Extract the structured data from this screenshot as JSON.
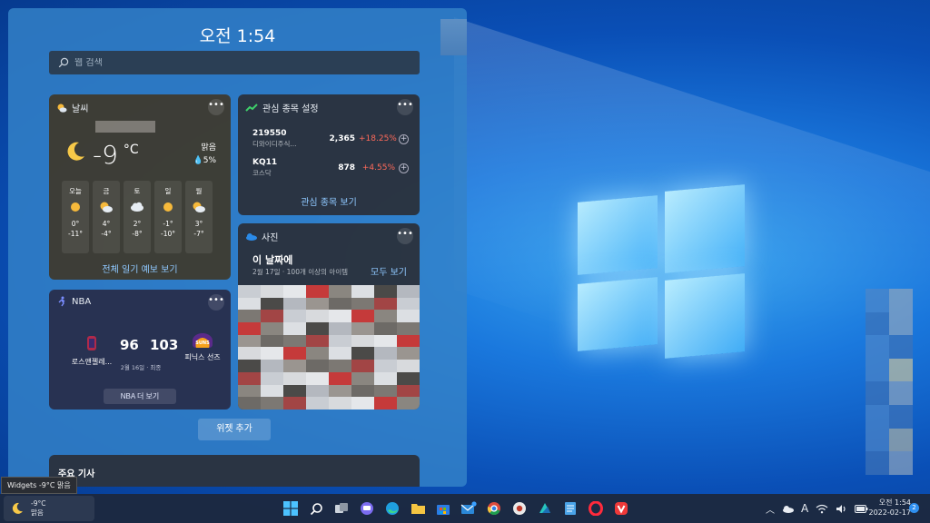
{
  "panel": {
    "clock": "오전 1:54",
    "search": {
      "placeholder": "웹 검색"
    }
  },
  "weather": {
    "title": "날씨",
    "temperature": "-9",
    "unit": "°C",
    "condition": "맑음",
    "precip": "5%",
    "forecast": [
      {
        "day": "오늘",
        "icon": "sun-icon",
        "high": "0°",
        "low": "-11°"
      },
      {
        "day": "금",
        "icon": "partly-cloudy-icon",
        "high": "4°",
        "low": "-4°"
      },
      {
        "day": "토",
        "icon": "cloud-icon",
        "high": "2°",
        "low": "-8°"
      },
      {
        "day": "일",
        "icon": "sun-icon",
        "high": "-1°",
        "low": "-10°"
      },
      {
        "day": "월",
        "icon": "partly-cloudy-icon",
        "high": "3°",
        "low": "-7°"
      }
    ],
    "link": "전체 일기 예보 보기"
  },
  "stocks": {
    "title": "관심 종목 설정",
    "rows": [
      {
        "symbol": "219550",
        "name": "디와이디주식...",
        "price": "2,365",
        "change": "+18.25%"
      },
      {
        "symbol": "KQ11",
        "name": "코스닥",
        "price": "878",
        "change": "+4.55%"
      }
    ],
    "link": "관심 종목 보기"
  },
  "photos": {
    "title": "사진",
    "heading": "이 날짜에",
    "subtitle": "2월 17일 · 100개 이상의 아이템",
    "see_all": "모두 보기"
  },
  "nba": {
    "title": "NBA",
    "home_team": "로스앤젤레...",
    "home_score": "96",
    "away_score": "103",
    "away_team": "피닉스 선즈",
    "away_logo_text": "SUNS",
    "status": "2월 16일 · 최종",
    "more": "NBA 더 보기"
  },
  "add_widget": "위젯 추가",
  "top_news": "주요 기사",
  "tooltip": "Widgets -9°C 맑음",
  "taskbar": {
    "weather_temp": "-9°C",
    "weather_cond": "맑음",
    "apps": [
      "start-icon",
      "search-icon",
      "task-view-icon",
      "chat-icon",
      "edge-icon",
      "file-explorer-icon",
      "store-icon",
      "mail-icon",
      "chrome-icon",
      "app-icon",
      "app-icon",
      "notepad-icon",
      "opera-icon",
      "vivaldi-icon"
    ],
    "tray_lang": "A",
    "time": "오전 1:54",
    "date": "2022-02-17",
    "notifications": "2"
  }
}
